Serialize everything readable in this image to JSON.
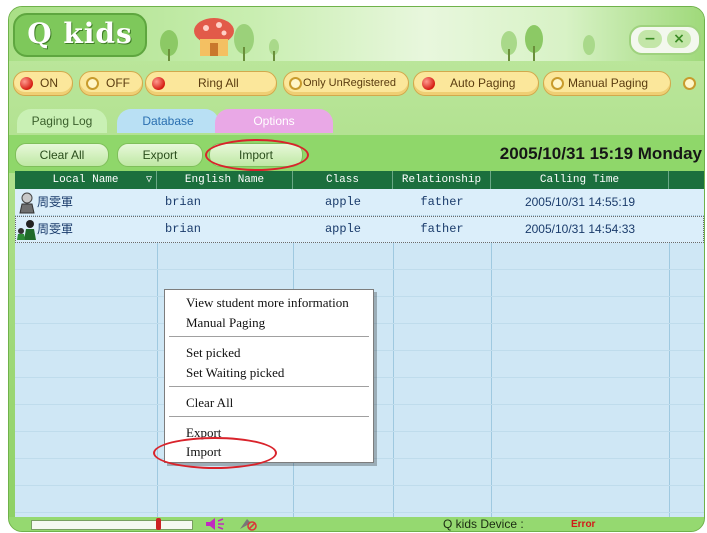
{
  "app": {
    "title": "Q kids"
  },
  "toolbar": {
    "on_label": "ON",
    "off_label": "OFF",
    "ring_all_label": "Ring All",
    "only_unregistered_label": "Only UnRegistered",
    "auto_paging_label": "Auto Paging",
    "manual_paging_label": "Manual Paging"
  },
  "tabs": [
    {
      "label": "Paging Log",
      "active": true
    },
    {
      "label": "Database",
      "active": false
    },
    {
      "label": "Options",
      "active": false
    }
  ],
  "actions": {
    "clear_all": "Clear All",
    "export": "Export",
    "import": "Import"
  },
  "datetime": "2005/10/31  15:19  Monday",
  "table": {
    "columns": [
      "Local Name",
      "English Name",
      "Class",
      "Relationship",
      "Calling Time"
    ],
    "rows": [
      {
        "local": "周雯軍",
        "english": "brian",
        "class": "apple",
        "relationship": "father",
        "time": "2005/10/31 14:55:19"
      },
      {
        "local": "周雯軍",
        "english": "brian",
        "class": "apple",
        "relationship": "father",
        "time": "2005/10/31 14:54:33"
      }
    ]
  },
  "context_menu": {
    "items": [
      "View student more information",
      "Manual Paging",
      "Set picked",
      "Set Waiting picked",
      "Clear All",
      "Export",
      "Import"
    ]
  },
  "status": {
    "device_label": "Q kids Device :",
    "device_status": "Error"
  },
  "colors": {
    "highlight": "#d9232b",
    "header": "#1b6f3d",
    "frame": "#8dd064"
  }
}
